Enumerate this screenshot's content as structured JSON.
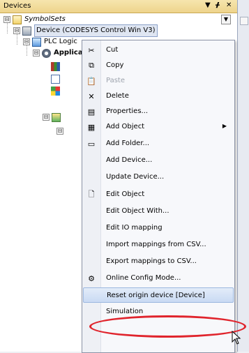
{
  "panel": {
    "title": "Devices",
    "controls": {
      "dropdown": "▼",
      "pin": "ᚋ",
      "close": "✕"
    }
  },
  "tree": {
    "root": {
      "label": "SymbolSets",
      "expander": "⊟",
      "icon": "folder-icon"
    },
    "device": {
      "label": "Device (CODESYS Control Win V3)",
      "expander": "⊟",
      "icon": "device-icon"
    },
    "plc_logic": {
      "label": "PLC Logic",
      "expander": "⊟",
      "icon": "plc-logic-icon"
    },
    "application": {
      "label": "Application",
      "expander": "⊟",
      "icon": "application-icon"
    },
    "task_config": {
      "expander": "⊟",
      "icon": "task-configuration-icon"
    },
    "task": {
      "expander": "⊟",
      "icon": "task-icon"
    },
    "dropdown_glyph": "▼"
  },
  "context_menu": {
    "items": [
      {
        "label": "Cut",
        "icon": "✂",
        "icon_name": "scissors-icon",
        "enabled": true
      },
      {
        "label": "Copy",
        "icon": "⧉",
        "icon_name": "copy-icon",
        "enabled": true
      },
      {
        "label": "Paste",
        "icon": "📋",
        "icon_name": "paste-icon",
        "enabled": false
      },
      {
        "label": "Delete",
        "icon": "✕",
        "icon_name": "delete-icon",
        "enabled": true
      },
      {
        "label": "Properties...",
        "icon": "▤",
        "icon_name": "properties-icon",
        "enabled": true
      },
      {
        "label": "Add Object",
        "icon": "▦",
        "icon_name": "add-object-icon",
        "enabled": true,
        "submenu": true,
        "arrow": "▶"
      },
      {
        "label": "Add Folder...",
        "icon": "▭",
        "icon_name": "folder-icon",
        "enabled": true
      },
      {
        "label": "Add Device...",
        "icon": "",
        "icon_name": "",
        "enabled": true
      },
      {
        "label": "Update Device...",
        "icon": "",
        "icon_name": "",
        "enabled": true
      },
      {
        "label": "Edit Object",
        "icon": "🗋",
        "icon_name": "edit-object-icon",
        "enabled": true
      },
      {
        "label": "Edit Object With...",
        "icon": "",
        "icon_name": "",
        "enabled": true
      },
      {
        "label": "Edit IO mapping",
        "icon": "",
        "icon_name": "",
        "enabled": true
      },
      {
        "label": "Import mappings from CSV...",
        "icon": "",
        "icon_name": "",
        "enabled": true
      },
      {
        "label": "Export mappings to CSV...",
        "icon": "",
        "icon_name": "",
        "enabled": true
      },
      {
        "label": "Online Config Mode...",
        "icon": "⚙",
        "icon_name": "online-config-icon",
        "enabled": true
      },
      {
        "label": "Reset origin device [Device]",
        "icon": "",
        "icon_name": "",
        "enabled": true,
        "highlighted": true
      },
      {
        "label": "Simulation",
        "icon": "",
        "icon_name": "",
        "enabled": true
      }
    ]
  },
  "colors": {
    "titlebar": "#eed48b",
    "highlight_ring": "#e0242c",
    "hover": "#c9daf3"
  }
}
